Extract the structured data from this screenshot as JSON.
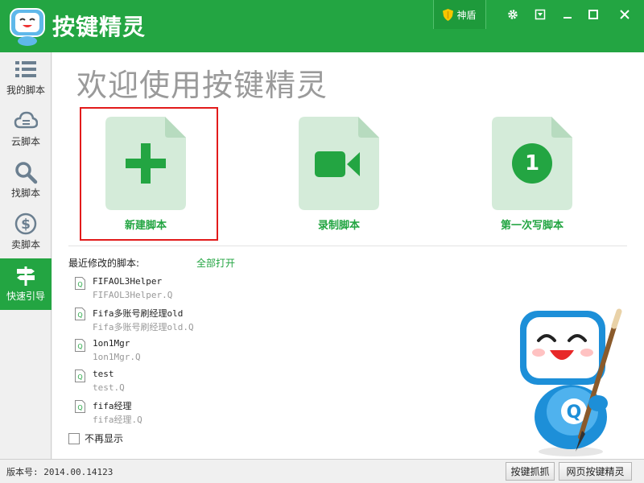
{
  "app": {
    "title": "按键精灵",
    "shield_label": "神盾"
  },
  "sidebar": {
    "items": [
      {
        "label": "我的脚本",
        "icon": "list-icon"
      },
      {
        "label": "云脚本",
        "icon": "cloud-icon"
      },
      {
        "label": "找脚本",
        "icon": "search-icon"
      },
      {
        "label": "卖脚本",
        "icon": "dollar-icon"
      },
      {
        "label": "快速引导",
        "icon": "signpost-icon",
        "active": true
      }
    ]
  },
  "main": {
    "welcome": "欢迎使用按键精灵",
    "tiles": [
      {
        "label": "新建脚本",
        "icon": "plus-icon"
      },
      {
        "label": "录制脚本",
        "icon": "video-camera-icon"
      },
      {
        "label": "第一次写脚本",
        "icon": "number-one-icon",
        "number": "1"
      }
    ],
    "recent_title": "最近修改的脚本:",
    "open_all": "全部打开",
    "files": [
      {
        "name": "FIFAOL3Helper",
        "path": "FIFAOL3Helper.Q"
      },
      {
        "name": "Fifa多账号刷经理old",
        "path": "Fifa多账号刷经理old.Q"
      },
      {
        "name": "1on1Mgr",
        "path": "1on1Mgr.Q"
      },
      {
        "name": "test",
        "path": "test.Q"
      },
      {
        "name": "fifa经理",
        "path": "fifa经理.Q"
      }
    ],
    "no_show_label": "不再显示"
  },
  "status": {
    "version": "版本号: 2014.00.14123",
    "btn_capture": "按键抓抓",
    "btn_web": "网页按键精灵"
  },
  "colors": {
    "brand_green": "#23a542",
    "tile_bg": "#d4ebd9",
    "highlight_red": "#e21b1b"
  }
}
